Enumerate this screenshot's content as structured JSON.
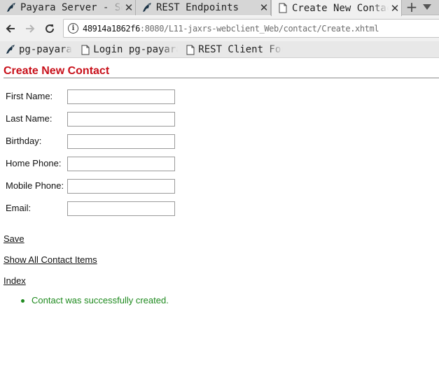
{
  "browser": {
    "tabs": [
      {
        "title": "Payara Server - Server",
        "favicon": "payara-fish-icon",
        "active": false
      },
      {
        "title": "REST Endpoints",
        "favicon": "payara-fish-icon",
        "active": false
      },
      {
        "title": "Create New Contact",
        "favicon": "page-icon",
        "active": true
      }
    ],
    "close_glyph": "✕",
    "new_tab_glyph": "+",
    "url_host": "48914a1862f6",
    "url_rest": ":8080/L11-jaxrs-webclient_Web/contact/Create.xhtml",
    "bookmarks": [
      {
        "label": "pg-payara",
        "icon": "payara-fish-icon"
      },
      {
        "label": "Login pg-payara",
        "icon": "page-icon"
      },
      {
        "label": "REST Client For",
        "icon": "page-icon"
      }
    ]
  },
  "page": {
    "title": "Create New Contact",
    "accent_color": "#c8101a",
    "form": {
      "fields": [
        {
          "label": "First Name:",
          "value": ""
        },
        {
          "label": "Last Name:",
          "value": ""
        },
        {
          "label": "Birthday:",
          "value": ""
        },
        {
          "label": "Home Phone:",
          "value": ""
        },
        {
          "label": "Mobile Phone:",
          "value": ""
        },
        {
          "label": "Email:",
          "value": ""
        }
      ]
    },
    "links": {
      "save": "Save",
      "show_all": "Show All Contact Items",
      "index": "Index"
    },
    "messages": [
      "Contact was successfully created."
    ],
    "message_color": "#1e8a1e"
  }
}
